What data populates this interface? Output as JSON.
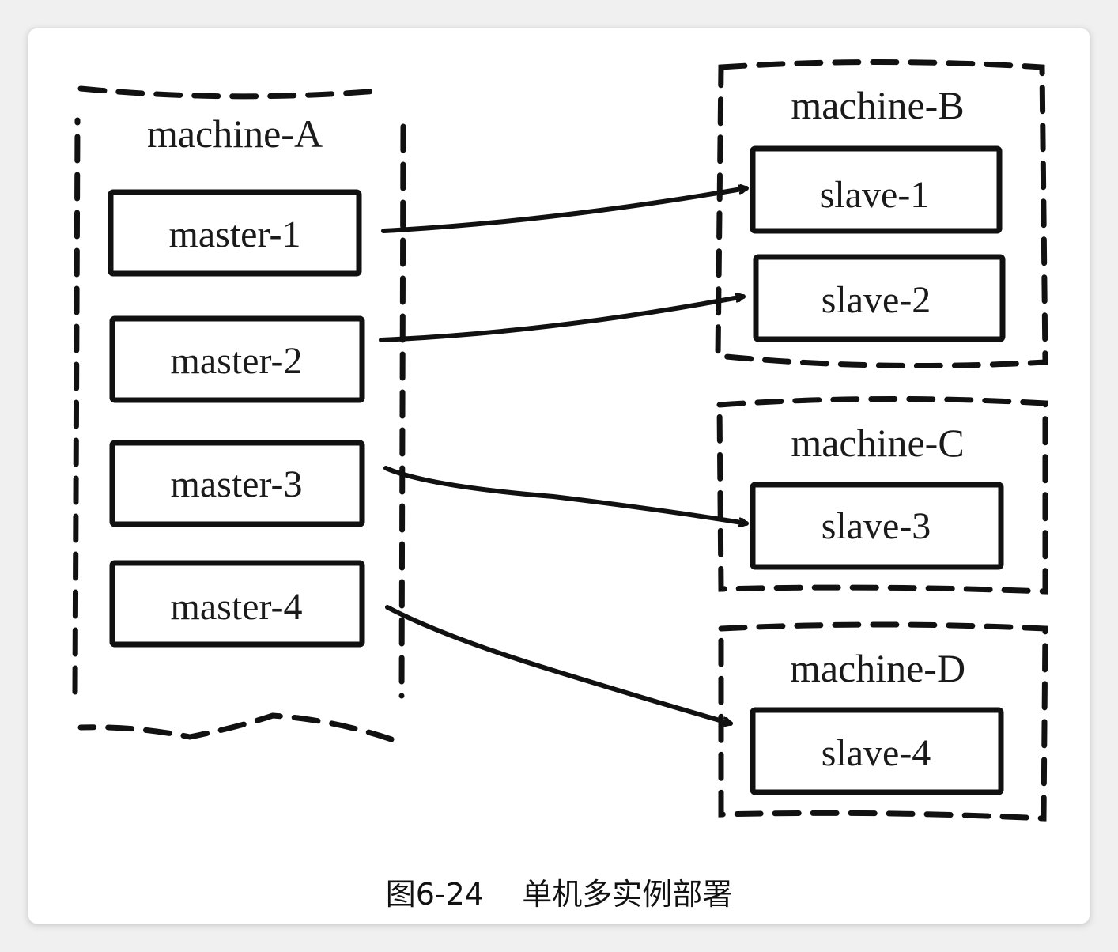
{
  "machines": [
    {
      "id": "machine-A",
      "label": "machine-A"
    },
    {
      "id": "machine-B",
      "label": "machine-B"
    },
    {
      "id": "machine-C",
      "label": "machine-C"
    },
    {
      "id": "machine-D",
      "label": "machine-D"
    }
  ],
  "nodes": {
    "master_1": "master-1",
    "master_2": "master-2",
    "master_3": "master-3",
    "master_4": "master-4",
    "slave_1": "slave-1",
    "slave_2": "slave-2",
    "slave_3": "slave-3",
    "slave_4": "slave-4"
  },
  "edges": [
    {
      "from": "master-1",
      "to": "slave-1"
    },
    {
      "from": "master-2",
      "to": "slave-2"
    },
    {
      "from": "master-3",
      "to": "slave-3"
    },
    {
      "from": "master-4",
      "to": "slave-4"
    }
  ],
  "caption": "图6-24    单机多实例部署"
}
